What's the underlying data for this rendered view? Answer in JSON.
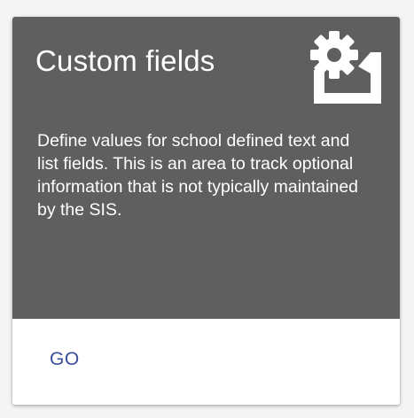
{
  "card": {
    "title": "Custom fields",
    "icon": "settings-applications-icon",
    "description": "Define values for school defined text and list fields. This is an area to track optional information that is not typically maintained by the SIS.",
    "action_label": "GO"
  },
  "colors": {
    "header_background": "#5f5f5f",
    "header_text": "#ffffff",
    "action_text": "#3a4e9c",
    "card_background": "#ffffff",
    "page_background": "#f4f4f4"
  }
}
